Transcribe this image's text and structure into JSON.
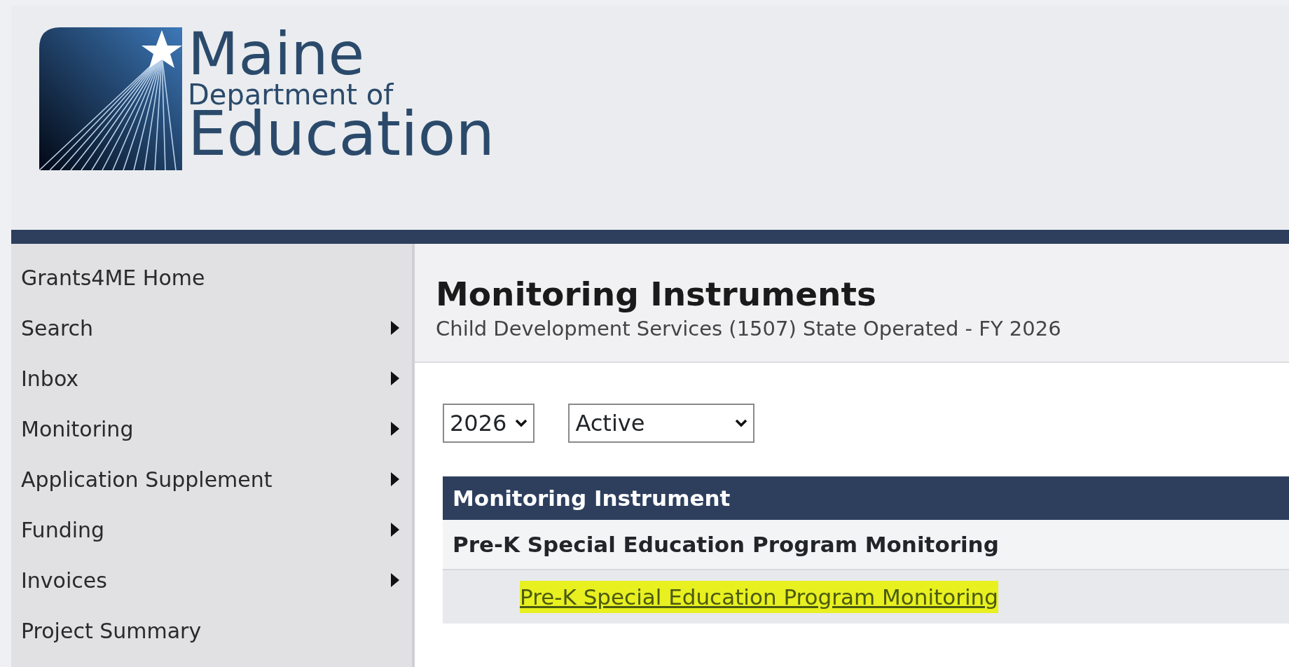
{
  "header": {
    "logo": {
      "line_1": "Maine",
      "line_2": "Department of",
      "line_3": "Education"
    }
  },
  "sidebar": {
    "items": [
      {
        "label": "Grants4ME Home",
        "has_submenu": false
      },
      {
        "label": "Search",
        "has_submenu": true
      },
      {
        "label": "Inbox",
        "has_submenu": true
      },
      {
        "label": "Monitoring",
        "has_submenu": true
      },
      {
        "label": "Application Supplement",
        "has_submenu": true
      },
      {
        "label": "Funding",
        "has_submenu": true
      },
      {
        "label": "Invoices",
        "has_submenu": true
      },
      {
        "label": "Project Summary",
        "has_submenu": false
      }
    ]
  },
  "page": {
    "title": "Monitoring Instruments",
    "subtitle": "Child Development Services (1507) State Operated - FY 2026"
  },
  "filters": [
    {
      "value": "2026"
    },
    {
      "value": "Active"
    }
  ],
  "table": {
    "columns": [
      "Monitoring Instrument"
    ],
    "groups": [
      {
        "title": "Pre-K Special Education Program Monitoring",
        "rows": [
          {
            "link": "Pre-K Special Education Program Monitoring",
            "highlighted": true
          }
        ]
      }
    ]
  }
}
